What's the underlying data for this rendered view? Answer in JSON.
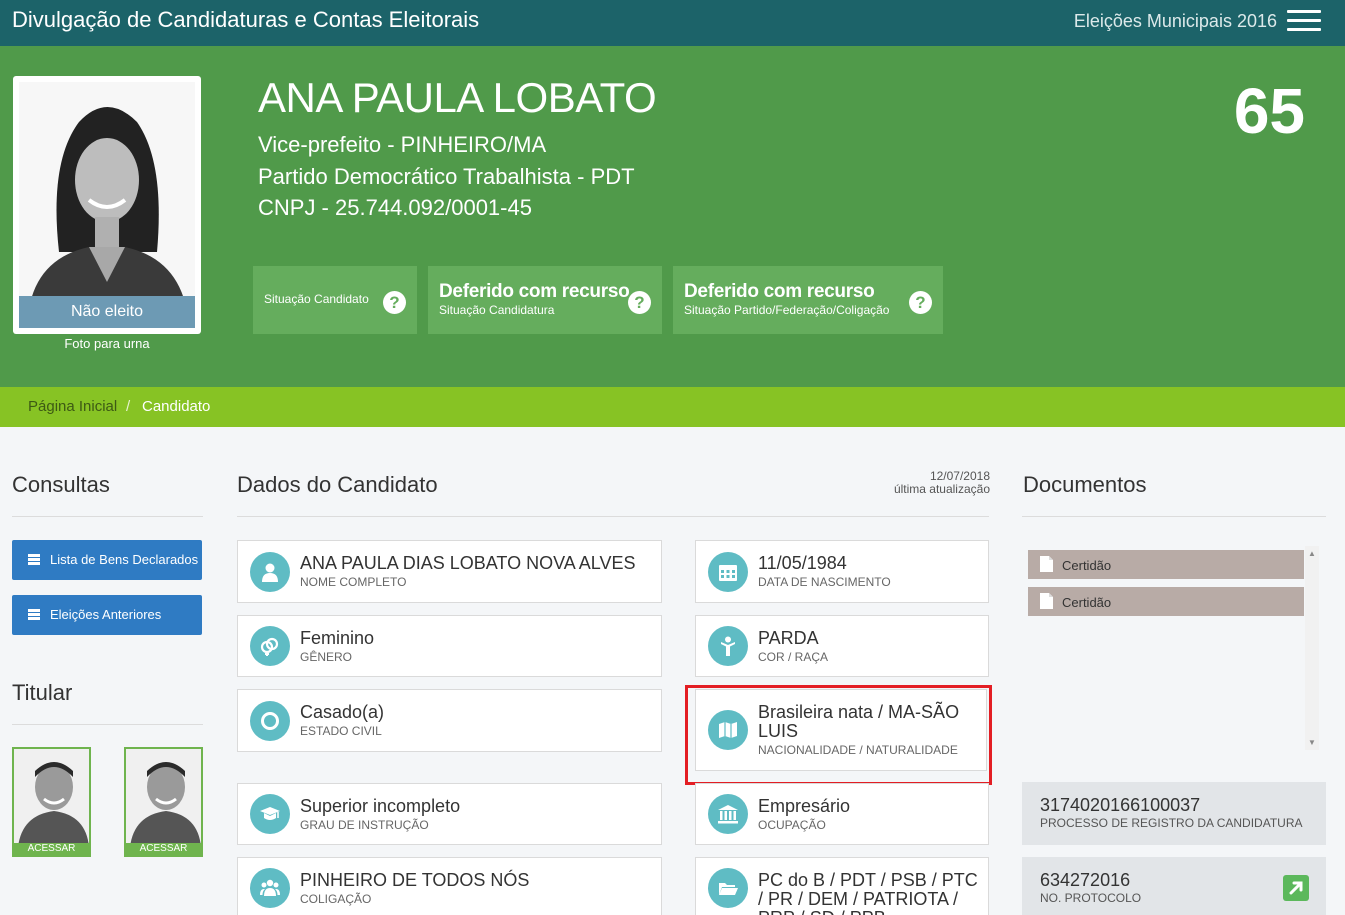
{
  "topbar": {
    "site_title": "Divulgação de Candidaturas e Contas Eleitorais",
    "election": "Eleições Municipais 2016"
  },
  "candidate": {
    "name": "ANA PAULA LOBATO",
    "office_line": "Vice-prefeito - PINHEIRO/MA",
    "party_line": "Partido Democrático Trabalhista - PDT",
    "cnpj_line": "CNPJ - 25.744.092/0001-45",
    "number": "65",
    "result_label": "Não eleito",
    "photo_caption": "Foto para urna"
  },
  "status_boxes": [
    {
      "big": "",
      "small": "Situação Candidato"
    },
    {
      "big": "Deferido com recurso",
      "small": "Situação Candidatura"
    },
    {
      "big": "Deferido com recurso",
      "small": "Situação Partido/Federação/Coligação"
    }
  ],
  "breadcrumb": {
    "home": "Página Inicial",
    "separator": "/",
    "current": "Candidato"
  },
  "consultas": {
    "title": "Consultas",
    "buttons": [
      "Lista de Bens Declarados",
      "Eleições Anteriores"
    ]
  },
  "titular": {
    "title": "Titular",
    "cards": [
      {
        "label": "ACESSAR"
      },
      {
        "label": "ACESSAR"
      }
    ]
  },
  "dados": {
    "title": "Dados do Candidato",
    "updated_date": "12/07/2018",
    "updated_label": "última atualização",
    "cards": [
      {
        "value": "ANA PAULA DIAS LOBATO NOVA ALVES",
        "label": "NOME COMPLETO",
        "icon": "user-icon"
      },
      {
        "value": "11/05/1984",
        "label": "DATA DE NASCIMENTO",
        "icon": "calendar-icon"
      },
      {
        "value": "Feminino",
        "label": "GÊNERO",
        "icon": "gender-icon"
      },
      {
        "value": "PARDA",
        "label": "COR / RAÇA",
        "icon": "person-icon"
      },
      {
        "value": "Casado(a)",
        "label": "ESTADO CIVIL",
        "icon": "ring-icon"
      },
      {
        "value": "Brasileira nata / MA-SÃO LUIS",
        "label": "NACIONALIDADE / NATURALIDADE",
        "icon": "map-icon"
      },
      {
        "value": "Superior incompleto",
        "label": "GRAU DE INSTRUÇÃO",
        "icon": "graduation-cap-icon"
      },
      {
        "value": "Empresário",
        "label": "OCUPAÇÃO",
        "icon": "bank-icon"
      },
      {
        "value": "PINHEIRO DE TODOS NÓS",
        "label": "COLIGAÇÃO",
        "icon": "group-icon"
      },
      {
        "value": "PC do B / PDT / PSB / PTC / PR / DEM / PATRIOTA / PRP / SD / PPB",
        "label": "",
        "icon": "folder-icon"
      }
    ]
  },
  "documentos": {
    "title": "Documentos",
    "items": [
      "Certidão",
      "Certidão"
    ],
    "process_number": "3174020166100037",
    "process_label": "PROCESSO DE REGISTRO DA CANDIDATURA",
    "protocol_number": "634272016",
    "protocol_label": "NO. PROTOCOLO"
  },
  "colors": {
    "topbar": "#1c6369",
    "hero": "#509a4a",
    "breadcrumb": "#87c324",
    "button": "#2f7bc3",
    "icon_circle": "#5fbcc4",
    "highlight": "#e31e24"
  }
}
